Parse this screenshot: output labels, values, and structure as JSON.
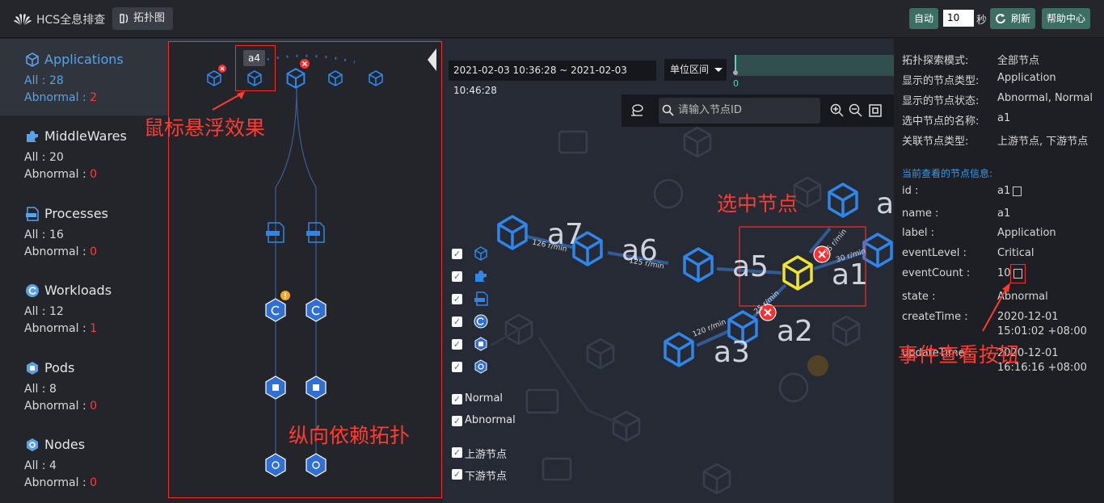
{
  "header": {
    "app_name": "HCS全息排查",
    "tab_label": "拓扑图",
    "auto_label": "自动",
    "interval_value": "10",
    "interval_unit": "秒",
    "refresh_label": "刷新",
    "help_label": "帮助中心"
  },
  "sidebar": {
    "categories": [
      {
        "name": "Applications",
        "all": "All : 28",
        "abnormal_prefix": "Abnormal : ",
        "abnormal": "2"
      },
      {
        "name": "MiddleWares",
        "all": "All : 20",
        "abnormal_prefix": "Abnormal : ",
        "abnormal": "0"
      },
      {
        "name": "Processes",
        "all": "All : 16",
        "abnormal_prefix": "Abnormal : ",
        "abnormal": "0"
      },
      {
        "name": "Workloads",
        "all": "All : 12",
        "abnormal_prefix": "Abnormal : ",
        "abnormal": "1"
      },
      {
        "name": "Pods",
        "all": "All : 8",
        "abnormal_prefix": "Abnormal : ",
        "abnormal": "0"
      },
      {
        "name": "Nodes",
        "all": "All : 4",
        "abnormal_prefix": "Abnormal : ",
        "abnormal": "0"
      }
    ]
  },
  "vertical_topology": {
    "hover_tooltip": "a4",
    "annotation_hover": "鼠标悬浮效果",
    "annotation_vertical": "纵向依赖拓扑"
  },
  "graph": {
    "time_range": "2021-02-03 10:36:28 ~ 2021-02-03 10:46:28",
    "unit_label": "单位区间",
    "slider_value": "0",
    "search_placeholder": "请输入节点ID",
    "annotation_selected": "选中节点",
    "annotation_event_btn": "事件查看按钮",
    "node_labels": {
      "a7": "a7",
      "a6": "a6",
      "a5": "a5",
      "a1": "a1",
      "a2": "a2",
      "a3": "a3",
      "a_partial": "a"
    },
    "rates": {
      "r1": "126 r/min",
      "r2": "125 r/min",
      "r3": "120 r/min",
      "r4": "25 r/min",
      "r5": "25 r/min",
      "r6": "30 r/min"
    },
    "filters": {
      "normal": "Normal",
      "abnormal": "Abnormal",
      "upstream": "上游节点",
      "downstream": "下游节点"
    }
  },
  "details": {
    "rows": [
      {
        "k": "拓扑探索模式:",
        "v": "全部节点"
      },
      {
        "k": "显示的节点类型:",
        "v": "Application"
      },
      {
        "k": "显示的节点状态:",
        "v": "Abnormal, Normal"
      },
      {
        "k": "选中节点的名称:",
        "v": "a1"
      },
      {
        "k": "关联节点类型:",
        "v": "上游节点, 下游节点"
      }
    ],
    "section_title": "当前查看的节点信息:",
    "info": [
      {
        "k": "id :",
        "v": "a1"
      },
      {
        "k": "name :",
        "v": "a1"
      },
      {
        "k": "label :",
        "v": "Application"
      },
      {
        "k": "eventLevel :",
        "v": "Critical"
      },
      {
        "k": "eventCount :",
        "v": "10"
      },
      {
        "k": "state :",
        "v": "Abnormal"
      },
      {
        "k": "createTime :",
        "v": "2020-12-01"
      },
      {
        "k": "updateTime :",
        "v": "2020-12-01"
      }
    ],
    "create_time_2": "15:01:02 +08:00",
    "update_time_2": "16:16:16 +08:00"
  },
  "colors": {
    "accent": "#5aa2e6",
    "danger": "#ff3b3b",
    "selected": "#f0e52d",
    "node_blue": "#2f86e8"
  }
}
